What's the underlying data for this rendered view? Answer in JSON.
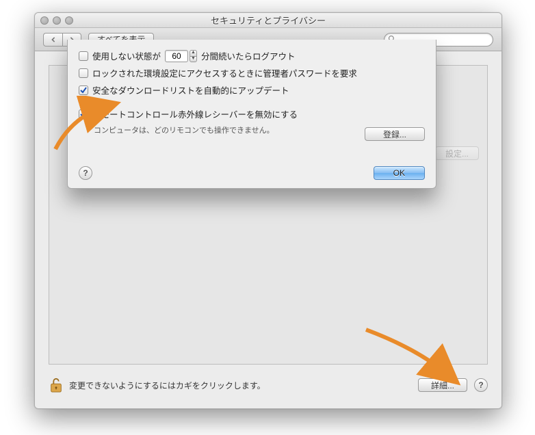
{
  "window": {
    "title": "セキュリティとプライバシー"
  },
  "toolbar": {
    "show_all": "すべてを表示",
    "search_placeholder": ""
  },
  "sheet": {
    "logout": {
      "checked": false,
      "prefix": "使用しない状態が",
      "minutes": "60",
      "suffix": "分間続いたらログアウト"
    },
    "admin_pw": {
      "checked": false,
      "label": "ロックされた環境設定にアクセスするときに管理者パスワードを要求"
    },
    "safe_downloads": {
      "checked": true,
      "label": "安全なダウンロードリストを自動的にアップデート"
    },
    "ir_disable": {
      "checked": true,
      "label": "リモートコントロール赤外線レシーバーを無効にする",
      "note": "コンピュータは、どのリモコンでも操作できません。"
    },
    "register_label": "登録...",
    "ok_label": "OK",
    "help_glyph": "?"
  },
  "footer": {
    "lock_text": "変更できないようにするにはカギをクリックします。",
    "advanced_label": "詳細...",
    "help_glyph": "?"
  },
  "ghost": {
    "settings": "設定..."
  }
}
